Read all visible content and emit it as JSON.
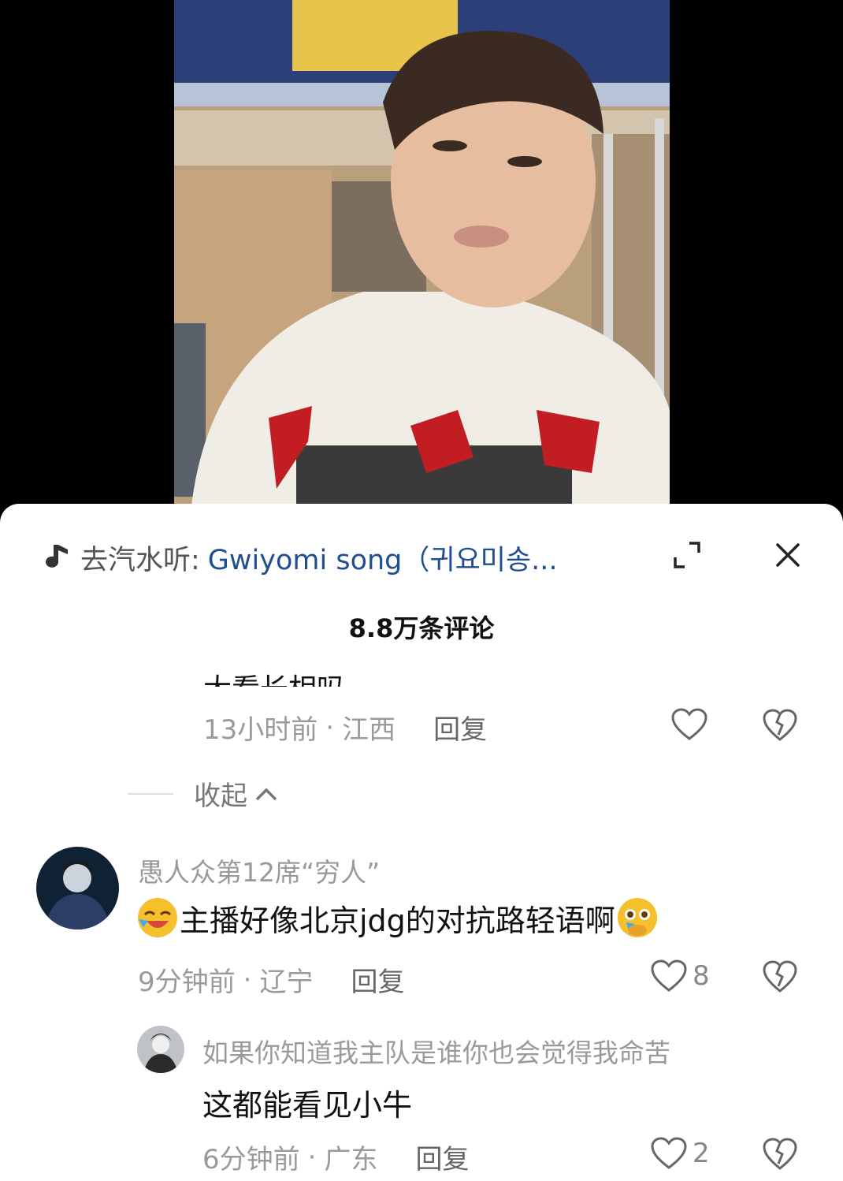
{
  "music": {
    "prefix": "去汽水听:",
    "song": "Gwiyomi song（귀요미송..."
  },
  "comments_title": "8.8万条评论",
  "partial_reply": {
    "text_fragment": "大看长相吗",
    "time": "13小时前",
    "location": "江西",
    "reply_label": "回复"
  },
  "collapse_label": "收起",
  "comment": {
    "username": "愚人众第12席“穷人”",
    "text": "主播好像北京jdg的对抗路轻语啊",
    "time": "9分钟前",
    "location": "辽宁",
    "reply_label": "回复",
    "likes": "8",
    "emoji_before": "laughing-emoji",
    "emoji_after": "crying-emoji"
  },
  "sub_reply": {
    "username": "如果你知道我主队是谁你也会觉得我命苦",
    "text": "这都能看见小牛",
    "time": "6分钟前",
    "location": "广东",
    "reply_label": "回复",
    "likes": "2"
  },
  "colors": {
    "link": "#1f4f8f",
    "meta": "#9a9a9a",
    "text": "#111111"
  }
}
